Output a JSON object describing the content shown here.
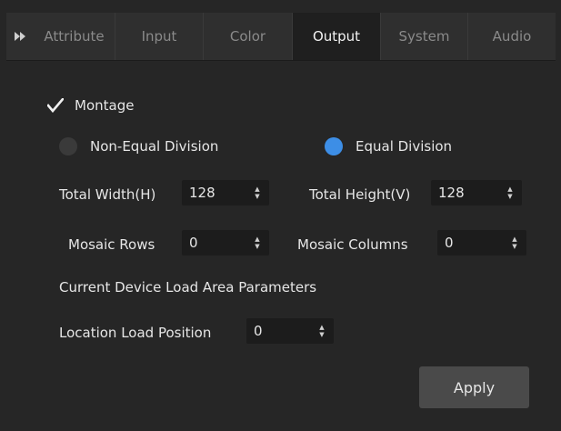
{
  "tabs": [
    {
      "label": "Attribute",
      "active": false
    },
    {
      "label": "Input",
      "active": false
    },
    {
      "label": "Color",
      "active": false
    },
    {
      "label": "Output",
      "active": true
    },
    {
      "label": "System",
      "active": false
    },
    {
      "label": "Audio",
      "active": false
    }
  ],
  "montage": {
    "label": "Montage",
    "checked": true
  },
  "division": {
    "non_equal_label": "Non-Equal Division",
    "equal_label": "Equal Division",
    "selected": "equal"
  },
  "fields": {
    "total_width": {
      "label": "Total Width(H)",
      "value": "128"
    },
    "total_height": {
      "label": "Total Height(V)",
      "value": "128"
    },
    "mosaic_rows": {
      "label": "Mosaic Rows",
      "value": "0"
    },
    "mosaic_columns": {
      "label": "Mosaic Columns",
      "value": "0"
    },
    "location_load_position": {
      "label": "Location Load Position",
      "value": "0"
    }
  },
  "section_title": "Current Device Load Area Parameters",
  "apply_label": "Apply",
  "colors": {
    "accent": "#3d8ee6",
    "background": "#262626",
    "tab_active": "#1f1f1f"
  }
}
